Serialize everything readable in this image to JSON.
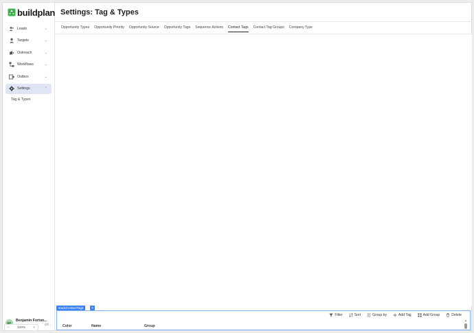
{
  "brand": {
    "name": "buildplan",
    "mark_color": "#3cb54a"
  },
  "sidebar": {
    "items": [
      {
        "label": "Leads",
        "icon": "users-icon",
        "chevron": "⌄"
      },
      {
        "label": "Targets",
        "icon": "person-icon",
        "chevron": "⌄"
      },
      {
        "label": "Outreach",
        "icon": "megaphone-icon",
        "chevron": "⌄"
      },
      {
        "label": "Workflows",
        "icon": "workflow-icon",
        "chevron": "⌄"
      },
      {
        "label": "Outbox",
        "icon": "outbox-icon",
        "chevron": "⌄"
      },
      {
        "label": "Settings",
        "icon": "gear-icon",
        "chevron": "⌃",
        "active": true
      }
    ],
    "sub_items": [
      {
        "label": "Tag & Types"
      }
    ],
    "user": {
      "initials": "BF",
      "name": "Benjamin Fortun...",
      "email": "@h..."
    },
    "zoom": {
      "minus": "−",
      "value": "100%",
      "plus": "+"
    }
  },
  "header": {
    "title": "Settings: Tag & Types"
  },
  "tabs": [
    {
      "label": "Opportunity Types"
    },
    {
      "label": "Opportunity Priority"
    },
    {
      "label": "Opportunity Source"
    },
    {
      "label": "Opportunity Tags"
    },
    {
      "label": "Sequence Actions"
    },
    {
      "label": "Contact Tags",
      "active": true
    },
    {
      "label": "Contact Tag Groups"
    },
    {
      "label": "Company Type"
    }
  ],
  "panel": {
    "stack_label": "stackContactTags",
    "stack_plus": "+",
    "toolbar": {
      "filter": "Filter",
      "sort": "Sort",
      "group_by": "Group by",
      "add_tag": "Add Tag",
      "add_group": "Add Group",
      "delete": "Delete"
    },
    "columns": [
      "Color",
      "Name",
      "Group"
    ]
  },
  "colors": {
    "accent": "#3b82f6",
    "active_nav_bg": "#dfe5f5"
  }
}
